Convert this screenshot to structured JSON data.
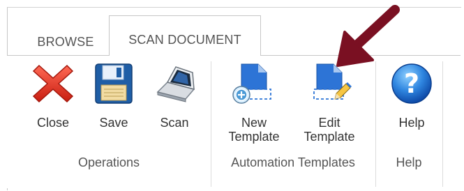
{
  "tabs": [
    {
      "label": "BROWSE",
      "active": false
    },
    {
      "label": "SCAN DOCUMENT",
      "active": true
    }
  ],
  "groups": [
    {
      "label": "Operations",
      "buttons": [
        {
          "label": "Close",
          "icon": "close-icon"
        },
        {
          "label": "Save",
          "icon": "save-disk-icon"
        },
        {
          "label": "Scan",
          "icon": "scanner-icon"
        }
      ]
    },
    {
      "label": "Automation Templates",
      "buttons": [
        {
          "label_line1": "New",
          "label_line2": "Template",
          "icon": "new-template-icon"
        },
        {
          "label_line1": "Edit",
          "label_line2": "Template",
          "icon": "edit-template-icon"
        }
      ]
    },
    {
      "label": "Help",
      "buttons": [
        {
          "label": "Help",
          "icon": "help-icon"
        }
      ]
    }
  ],
  "colors": {
    "accent_blue": "#1e6fd0",
    "close_red": "#e03a2a",
    "annotation_arrow": "#7a1022"
  }
}
